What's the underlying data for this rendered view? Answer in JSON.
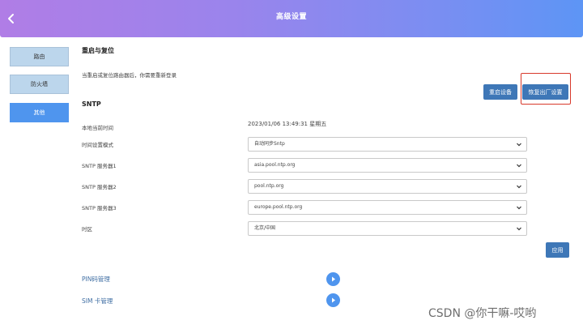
{
  "header": {
    "title": "高级设置"
  },
  "sidebar": {
    "items": [
      {
        "label": "路由"
      },
      {
        "label": "防火墙"
      },
      {
        "label": "其他"
      }
    ]
  },
  "reboot_section": {
    "title": "重启与复位",
    "note": "当重启或复位路由器后，你需要重新登录",
    "reboot_button": "重启设备",
    "factory_reset_button": "恢复出厂设置"
  },
  "sntp": {
    "title": "SNTP",
    "local_time_label": "本地当前时间",
    "local_time_value": "2023/01/06 13:49:31 星期五",
    "mode_label": "时间设置模式",
    "mode_value": "自动同步Sntp",
    "server1_label": "SNTP 服务器1",
    "server1_value": "asia.pool.ntp.org",
    "server2_label": "SNTP 服务器2",
    "server2_value": "pool.ntp.org",
    "server3_label": "SNTP 服务器3",
    "server3_value": "europe.pool.ntp.org",
    "timezone_label": "时区",
    "timezone_value": "北京/中国",
    "apply_button": "应用"
  },
  "links": {
    "pin": "PIN码管理",
    "sim": "SIM 卡管理"
  },
  "watermark": "CSDN @你干嘛-哎哟",
  "icons": {
    "back": "chevron-left-icon",
    "select": "chevron-down-icon",
    "expand": "play-circle-icon"
  },
  "colors": {
    "header_gradient_start": "#b07de6",
    "header_gradient_end": "#5d95f5",
    "sidebar_active": "#4f95ee",
    "button": "#3e77b7",
    "highlight": "#d8392b"
  }
}
